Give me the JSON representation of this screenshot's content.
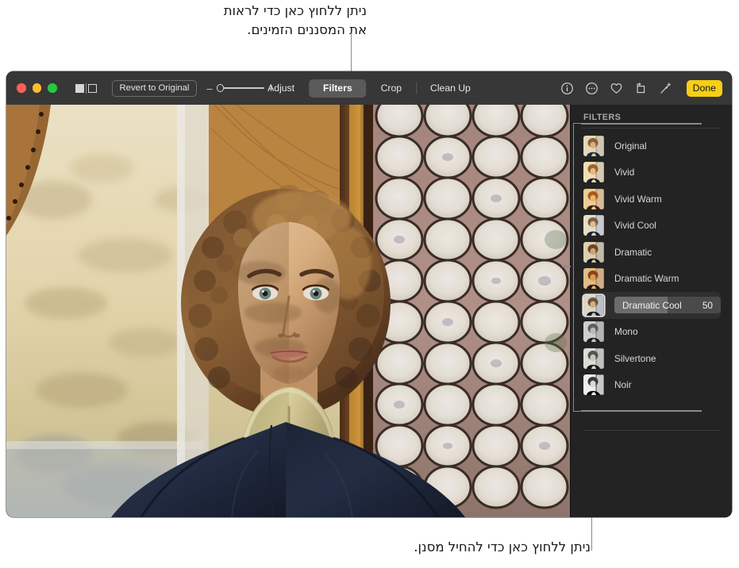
{
  "callouts": {
    "top": "ניתן ללחוץ כאן כדי לראות\nאת המסננים הזמינים.",
    "bottom": "ניתן ללחוץ כאן כדי להחיל מסנן."
  },
  "window": {
    "traffic_lights": {
      "close": "close-button",
      "minimize": "minimize-button",
      "zoom": "zoom-button",
      "colors": {
        "close": "#ff5f57",
        "minimize": "#febc2e",
        "zoom": "#28c840"
      }
    },
    "toolbar": {
      "view_toggle": {
        "filled": "split-view-filled",
        "outline": "split-view-outline"
      },
      "revert_label": "Revert to Original",
      "zoom_slider": {
        "minus": "–",
        "plus": "+",
        "value": 0
      },
      "segments": [
        {
          "label": "Adjust",
          "active": false
        },
        {
          "label": "Filters",
          "active": true
        },
        {
          "label": "Crop",
          "active": false
        },
        {
          "label": "Clean Up",
          "active": false
        }
      ],
      "right_icons": [
        {
          "name": "info-icon",
          "glyph": "i"
        },
        {
          "name": "more-options-icon",
          "glyph": "..."
        },
        {
          "name": "favorite-heart-icon",
          "glyph": "heart"
        },
        {
          "name": "rotate-icon",
          "glyph": "rotate"
        },
        {
          "name": "enhance-wand-icon",
          "glyph": "wand"
        }
      ],
      "done_label": "Done",
      "done_color": "#f6cf16"
    }
  },
  "sidebar": {
    "title": "FILTERS",
    "filters": [
      {
        "label": "Original",
        "selected": false
      },
      {
        "label": "Vivid",
        "selected": false
      },
      {
        "label": "Vivid Warm",
        "selected": false
      },
      {
        "label": "Vivid Cool",
        "selected": false
      },
      {
        "label": "Dramatic",
        "selected": false
      },
      {
        "label": "Dramatic Warm",
        "selected": false
      },
      {
        "label": "Dramatic Cool",
        "selected": true,
        "value": "50",
        "intensity_pct": 50
      },
      {
        "label": "Mono",
        "selected": false
      },
      {
        "label": "Silvertone",
        "selected": false
      },
      {
        "label": "Noir",
        "selected": false
      }
    ]
  },
  "photo": {
    "name": "portrait-photo",
    "description": "Portrait of a person with curly hair beside a stained-glass window"
  }
}
